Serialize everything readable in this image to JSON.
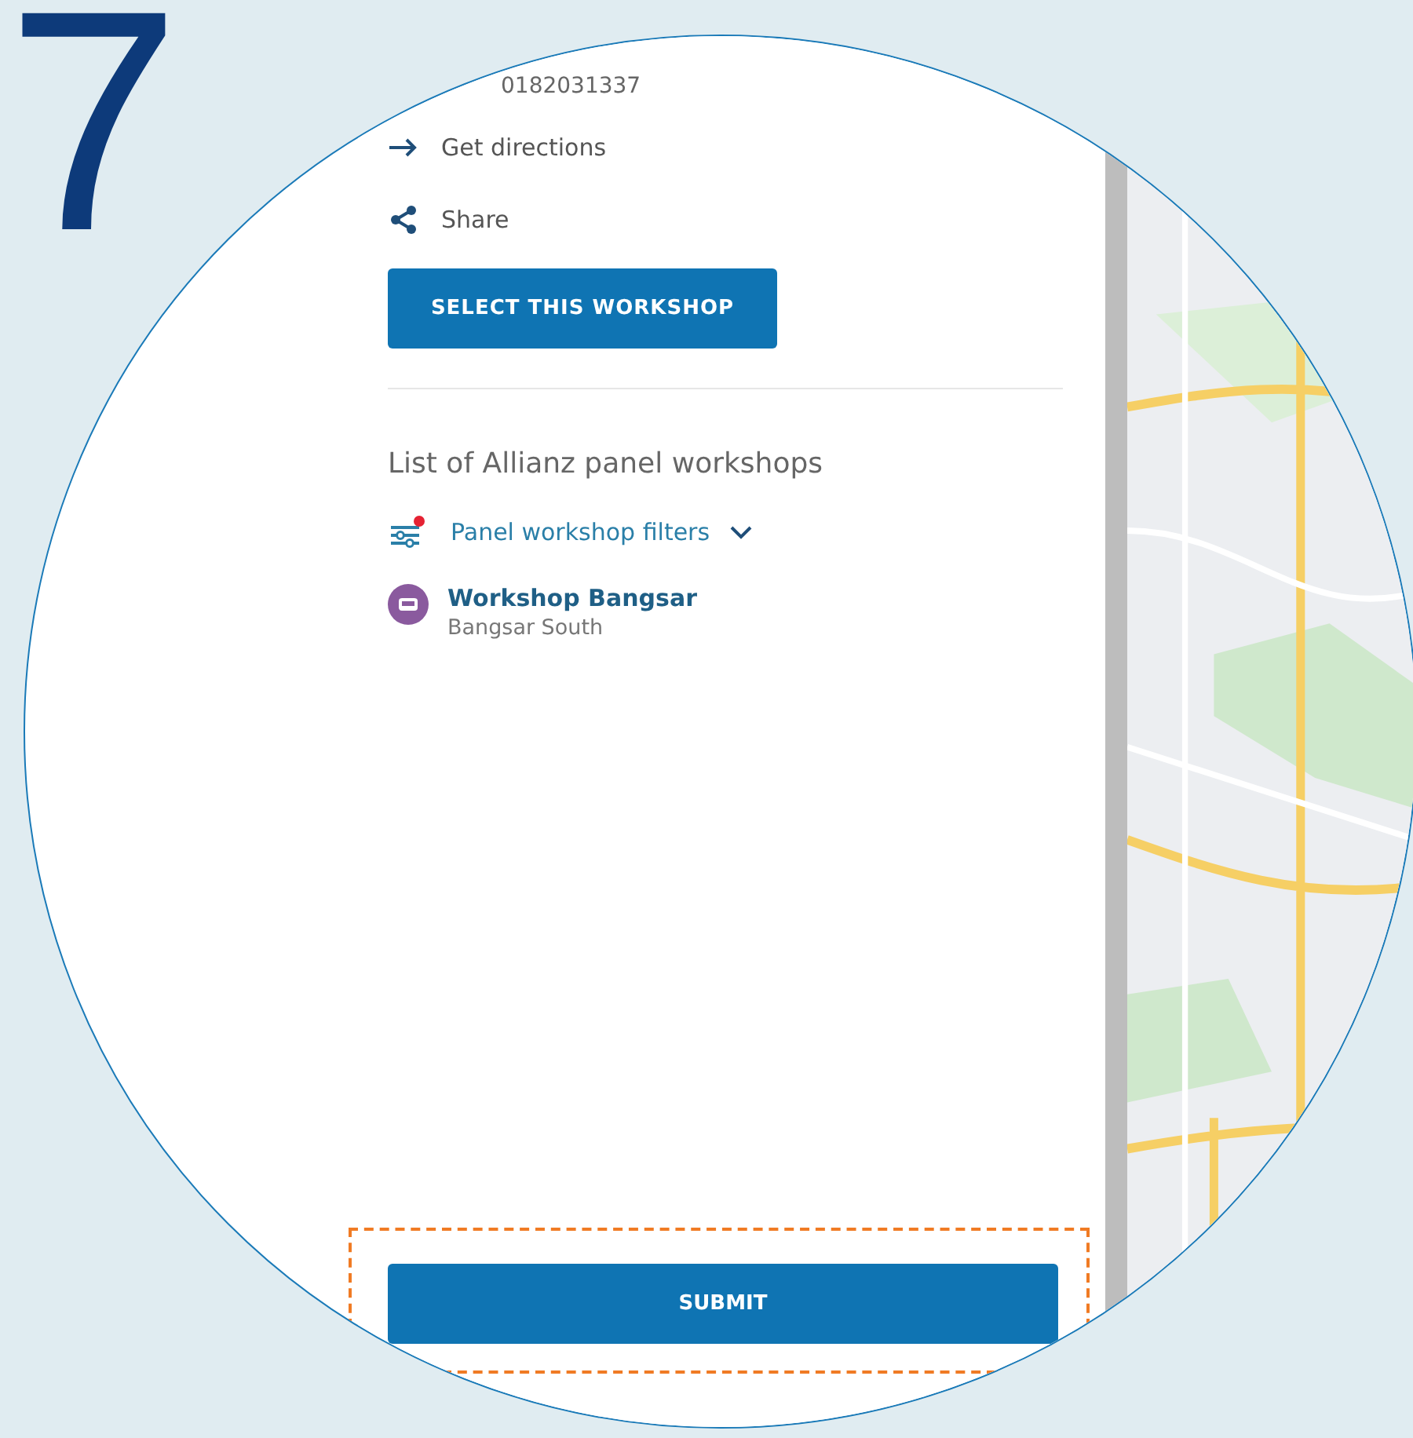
{
  "step_number": "7",
  "workshop_details": {
    "phone": "0182031337",
    "actions": [
      {
        "kind": "directions",
        "label": "Get directions"
      },
      {
        "kind": "share",
        "label": "Share"
      }
    ],
    "select_button": "SELECT THIS WORKSHOP"
  },
  "panel_list": {
    "heading": "List of Allianz panel workshops",
    "filters": {
      "label": "Panel workshop filters",
      "applied": true
    },
    "workshops": [
      {
        "name": "Workshop Bangsar",
        "area": "Bangsar South"
      }
    ]
  },
  "submit_button": "SUBMIT"
}
